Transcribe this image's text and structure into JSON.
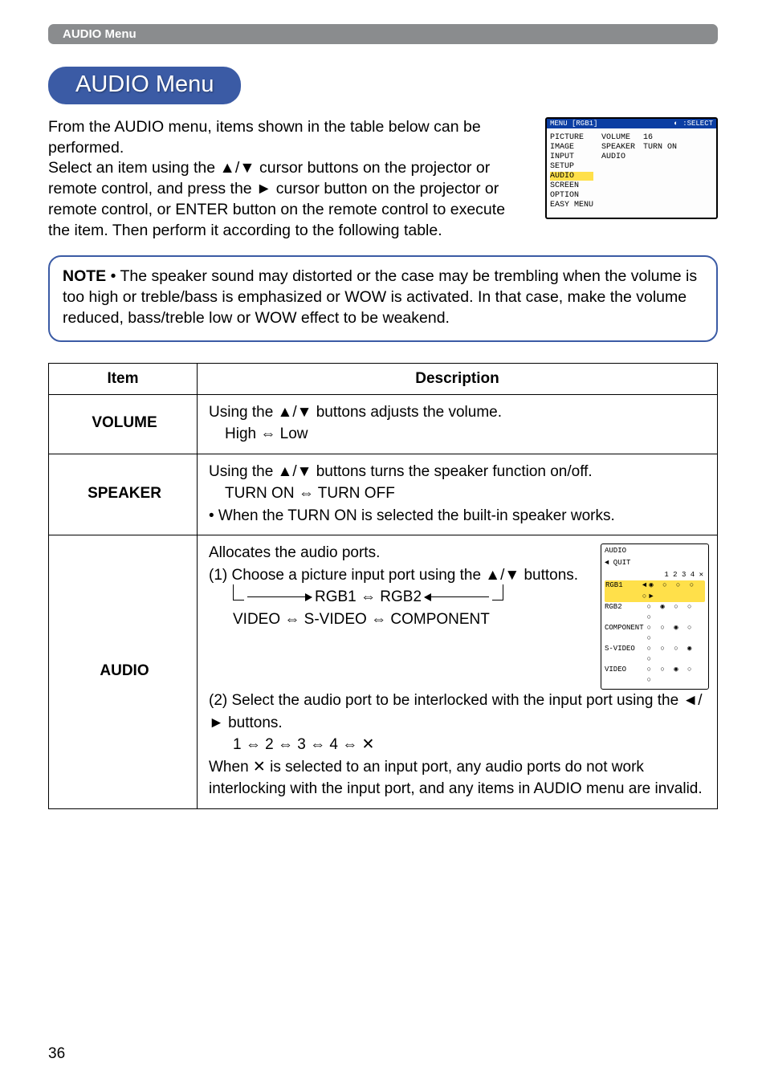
{
  "header_label": "AUDIO Menu",
  "title": "AUDIO Menu",
  "intro": "From the AUDIO menu, items shown in the table below can be performed.\nSelect an item using the ▲/▼ cursor buttons on the projector or remote control, and press the ► cursor button on the projector or remote control, or ENTER button on the remote control to execute the item. Then perform it according to the following table.",
  "note_label": "NOTE",
  "note_text": " • The speaker sound may distorted or the case may be trembling when the volume is too high or treble/bass is emphasized or WOW is activated. In that case, make the volume reduced, bass/treble low or WOW effect to be weakend.",
  "table": {
    "head_item": "Item",
    "head_desc": "Description",
    "rows": [
      {
        "item": "VOLUME",
        "desc_line1": "Using the ▲/▼ buttons adjusts the volume.",
        "desc_line2": "High ⇔ Low"
      },
      {
        "item": "SPEAKER",
        "desc_line1": "Using the ▲/▼ buttons turns the speaker function on/off.",
        "desc_line2": "TURN ON ⇔ TURN OFF",
        "desc_line3": "• When the TURN ON is selected the built-in speaker works."
      },
      {
        "item": "AUDIO",
        "p1": "Allocates the audio ports.",
        "p2": "(1) Choose a picture input port using the ▲/▼ buttons.",
        "seq1a": "RGB1 ⇔ RGB2",
        "seq1b": "VIDEO ⇔ S-VIDEO ⇔ COMPONENT",
        "p3": "(2) Select the audio port to be interlocked with the input port using the ◄/► buttons.",
        "seq2": "1 ⇔ 2 ⇔ 3 ⇔ 4 ⇔ ",
        "mute_glyph": "✕",
        "p4a": "When ",
        "p4b": " is selected to an input port, any audio ports do not work interlocking with the input port, and any items in AUDIO menu are invalid."
      }
    ]
  },
  "osd_main": {
    "hdr_left": "MENU [RGB1]",
    "hdr_right_icon": "◐",
    "hdr_right": ":SELECT",
    "left_col": [
      "PICTURE",
      "IMAGE",
      "INPUT",
      "SETUP",
      "AUDIO",
      "SCREEN",
      "OPTION",
      "EASY MENU"
    ],
    "mid_col": [
      "VOLUME",
      "SPEAKER",
      "AUDIO"
    ],
    "right_col": [
      "16",
      "TURN ON",
      ""
    ],
    "selected": "AUDIO"
  },
  "osd_audio": {
    "title": "AUDIO",
    "quit": "◄ QUIT",
    "cols": "1  2  3  4 ✕",
    "rows": [
      {
        "label": "RGB1",
        "dots": "◄◉ ○ ○ ○ ○►",
        "sel": true
      },
      {
        "label": "RGB2",
        "dots": "○ ◉ ○ ○ ○"
      },
      {
        "label": "COMPONENT",
        "dots": "○ ○ ◉ ○ ○"
      },
      {
        "label": "S-VIDEO",
        "dots": "○ ○ ○ ◉ ○"
      },
      {
        "label": "VIDEO",
        "dots": "○ ○ ◉ ○ ○"
      }
    ]
  },
  "page_number": "36"
}
